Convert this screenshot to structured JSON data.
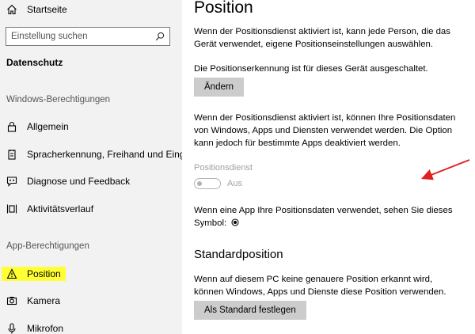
{
  "sidebar": {
    "home_label": "Startseite",
    "search": {
      "placeholder": "Einstellung suchen",
      "value": ""
    },
    "category_title": "Datenschutz",
    "sections": [
      {
        "label": "Windows-Berechtigungen",
        "items": [
          {
            "label": "Allgemein",
            "icon": "lock-icon"
          },
          {
            "label": "Spracherkennung, Freihand und Eingabe",
            "icon": "notepad-icon"
          },
          {
            "label": "Diagnose und Feedback",
            "icon": "feedback-icon"
          },
          {
            "label": "Aktivitätsverlauf",
            "icon": "timeline-icon"
          }
        ]
      },
      {
        "label": "App-Berechtigungen",
        "items": [
          {
            "label": "Position",
            "icon": "location-icon",
            "selected": true,
            "highlight_color": "#ffff33"
          },
          {
            "label": "Kamera",
            "icon": "camera-icon"
          },
          {
            "label": "Mikrofon",
            "icon": "microphone-icon"
          }
        ]
      }
    ]
  },
  "main": {
    "title": "Position",
    "intro": "Wenn der Positionsdienst aktiviert ist, kann jede Person, die das Gerät verwendet, eigene Positionseinstellungen auswählen.",
    "device_status": "Die Positionserkennung ist für dieses Gerät ausgeschaltet.",
    "change_button": "Ändern",
    "service_description": "Wenn der Positionsdienst aktiviert ist, können Ihre Positionsdaten von Windows, Apps und Diensten verwendet werden. Die Option kann jedoch für bestimmte Apps deaktiviert werden.",
    "toggle": {
      "label": "Positionsdienst",
      "state_text": "Aus",
      "on": false
    },
    "symbol_text": "Wenn eine App Ihre Positionsdaten verwendet, sehen Sie dieses Symbol:",
    "default_position": {
      "title": "Standardposition",
      "description": "Wenn auf diesem PC keine genauere Position erkannt wird, können Windows, Apps und Dienste diese Position verwenden.",
      "button": "Als Standard festlegen"
    }
  },
  "colors": {
    "sidebar_bg": "#f2f2f2",
    "button_bg": "#cccccc",
    "highlight": "#ffff33",
    "annotation_arrow": "#e02020",
    "disabled_text": "#a0a0a0"
  }
}
